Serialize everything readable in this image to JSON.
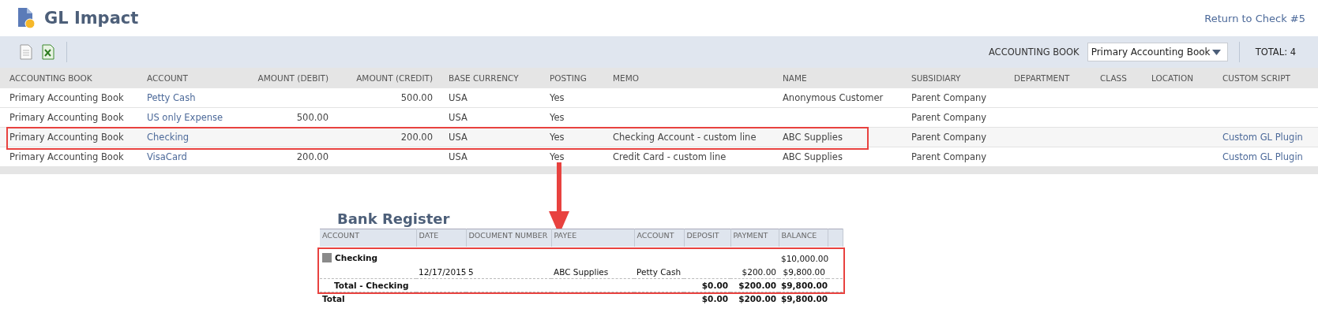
{
  "page": {
    "title": "GL Impact",
    "back_link": "Return to Check #5"
  },
  "toolbar": {
    "book_label": "ACCOUNTING BOOK",
    "book_value": "Primary Accounting Book",
    "total": "TOTAL: 4"
  },
  "table": {
    "columns": [
      "ACCOUNTING BOOK",
      "ACCOUNT",
      "AMOUNT (DEBIT)",
      "AMOUNT (CREDIT)",
      "BASE CURRENCY",
      "POSTING",
      "MEMO",
      "NAME",
      "SUBSIDIARY",
      "DEPARTMENT",
      "CLASS",
      "LOCATION",
      "CUSTOM SCRIPT"
    ],
    "rows": [
      {
        "outlined": false,
        "cells": [
          "Primary Accounting Book",
          "Petty Cash",
          "",
          "500.00",
          "USA",
          "Yes",
          "",
          "Anonymous Customer",
          "Parent Company",
          "",
          "",
          "",
          ""
        ]
      },
      {
        "outlined": false,
        "cells": [
          "Primary Accounting Book",
          "US only Expense",
          "500.00",
          "",
          "USA",
          "Yes",
          "",
          "",
          "Parent Company",
          "",
          "",
          "",
          ""
        ]
      },
      {
        "outlined": true,
        "cells": [
          "Primary Accounting Book",
          "Checking",
          "",
          "200.00",
          "USA",
          "Yes",
          "Checking Account - custom line",
          "ABC Supplies",
          "Parent Company",
          "",
          "",
          "",
          "Custom GL Plugin"
        ]
      },
      {
        "outlined": false,
        "cells": [
          "Primary Accounting Book",
          "VisaCard",
          "200.00",
          "",
          "USA",
          "Yes",
          "Credit Card - custom line",
          "ABC Supplies",
          "Parent Company",
          "",
          "",
          "",
          "Custom GL Plugin"
        ]
      }
    ]
  },
  "register": {
    "title": "Bank Register",
    "columns": [
      "ACCOUNT",
      "DATE",
      "DOCUMENT NUMBER",
      "PAYEE",
      "ACCOUNT",
      "DEPOSIT",
      "PAYMENT",
      "BALANCE"
    ],
    "rows": [
      {
        "kind": "group",
        "outlined": true,
        "expanded": true,
        "cells": [
          "Checking",
          "",
          "",
          "",
          "",
          "",
          "",
          "$10,000.00"
        ]
      },
      {
        "kind": "line",
        "outlined": true,
        "cells": [
          "",
          "12/17/2015",
          "5",
          "ABC Supplies",
          "Petty Cash",
          "",
          "$200.00",
          "$9,800.00"
        ]
      },
      {
        "kind": "subtotal",
        "outlined": true,
        "cells": [
          "Total - Checking",
          "",
          "",
          "",
          "",
          "$0.00",
          "$200.00",
          "$9,800.00"
        ]
      },
      {
        "kind": "total",
        "outlined": false,
        "cells": [
          "Total",
          "",
          "",
          "",
          "",
          "$0.00",
          "$200.00",
          "$9,800.00"
        ]
      }
    ]
  }
}
